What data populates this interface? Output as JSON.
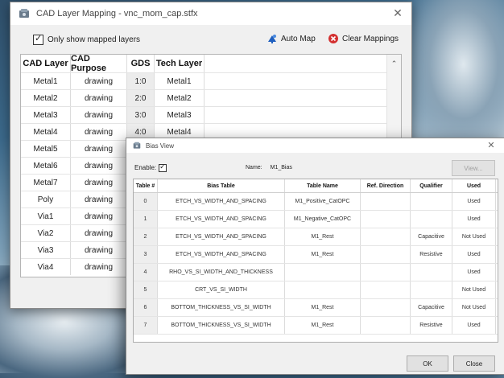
{
  "cad_window": {
    "title": "CAD Layer Mapping - vnc_mom_cap.stfx",
    "only_mapped_label": "Only show mapped layers",
    "only_mapped_checked": true,
    "auto_map_label": "Auto Map",
    "clear_mappings_label": "Clear Mappings",
    "columns": [
      "CAD Layer",
      "CAD Purpose",
      "GDS",
      "Tech Layer"
    ],
    "rows": [
      {
        "layer": "Metal1",
        "purpose": "drawing",
        "gds": "1:0",
        "tech": "Metal1"
      },
      {
        "layer": "Metal2",
        "purpose": "drawing",
        "gds": "2:0",
        "tech": "Metal2"
      },
      {
        "layer": "Metal3",
        "purpose": "drawing",
        "gds": "3:0",
        "tech": "Metal3"
      },
      {
        "layer": "Metal4",
        "purpose": "drawing",
        "gds": "4:0",
        "tech": "Metal4"
      },
      {
        "layer": "Metal5",
        "purpose": "drawing",
        "gds": "",
        "tech": ""
      },
      {
        "layer": "Metal6",
        "purpose": "drawing",
        "gds": "",
        "tech": ""
      },
      {
        "layer": "Metal7",
        "purpose": "drawing",
        "gds": "",
        "tech": ""
      },
      {
        "layer": "Poly",
        "purpose": "drawing",
        "gds": "",
        "tech": ""
      },
      {
        "layer": "Via1",
        "purpose": "drawing",
        "gds": "",
        "tech": ""
      },
      {
        "layer": "Via2",
        "purpose": "drawing",
        "gds": "",
        "tech": ""
      },
      {
        "layer": "Via3",
        "purpose": "drawing",
        "gds": "",
        "tech": ""
      },
      {
        "layer": "Via4",
        "purpose": "drawing",
        "gds": "",
        "tech": ""
      }
    ]
  },
  "bias_window": {
    "title": "Bias View",
    "enable_label": "Enable:",
    "enable_checked": true,
    "name_label": "Name:",
    "name_value": "M1_Bias",
    "view_button": "View...",
    "columns": [
      "Table #",
      "Bias Table",
      "Table Name",
      "Ref. Direction",
      "Qualifier",
      "Used"
    ],
    "rows": [
      {
        "idx": "0",
        "bias": "ETCH_VS_WIDTH_AND_SPACING",
        "name": "M1_Positive_CatOPC",
        "ref": "",
        "qual": "",
        "used": "Used"
      },
      {
        "idx": "1",
        "bias": "ETCH_VS_WIDTH_AND_SPACING",
        "name": "M1_Negative_CatOPC",
        "ref": "",
        "qual": "",
        "used": "Used"
      },
      {
        "idx": "2",
        "bias": "ETCH_VS_WIDTH_AND_SPACING",
        "name": "M1_Rest",
        "ref": "",
        "qual": "Capacitive",
        "used": "Not Used"
      },
      {
        "idx": "3",
        "bias": "ETCH_VS_WIDTH_AND_SPACING",
        "name": "M1_Rest",
        "ref": "",
        "qual": "Resistive",
        "used": "Used"
      },
      {
        "idx": "4",
        "bias": "RHO_VS_SI_WIDTH_AND_THICKNESS",
        "name": "",
        "ref": "",
        "qual": "",
        "used": "Used"
      },
      {
        "idx": "5",
        "bias": "CRT_VS_SI_WIDTH",
        "name": "",
        "ref": "",
        "qual": "",
        "used": "Not Used"
      },
      {
        "idx": "6",
        "bias": "BOTTOM_THICKNESS_VS_SI_WIDTH",
        "name": "M1_Rest",
        "ref": "",
        "qual": "Capacitive",
        "used": "Not Used"
      },
      {
        "idx": "7",
        "bias": "BOTTOM_THICKNESS_VS_SI_WIDTH",
        "name": "M1_Rest",
        "ref": "",
        "qual": "Resistive",
        "used": "Used"
      }
    ],
    "ok_button": "OK",
    "close_button": "Close"
  },
  "colors": {
    "accent_blue": "#1f5fbf",
    "clear_red": "#d33030"
  },
  "icons": [
    "app-icon",
    "close-icon",
    "auto-map-icon",
    "clear-mappings-icon",
    "scroll-up-icon"
  ]
}
